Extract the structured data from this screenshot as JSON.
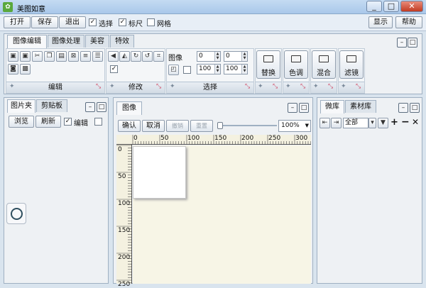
{
  "window": {
    "title": "美图如意",
    "min": "_",
    "max": "□",
    "close": "✕"
  },
  "toolbar": {
    "open": "打开",
    "save": "保存",
    "exit": "退出",
    "select": "选择",
    "ruler": "标尺",
    "grid": "网格",
    "show": "显示",
    "help": "帮助"
  },
  "ribbon": {
    "tabs": [
      "图像编辑",
      "图像处理",
      "美容",
      "特效"
    ],
    "groups": {
      "edit": "编辑",
      "modify": "修改",
      "select": "选择"
    },
    "image_label": "图像",
    "spinners": [
      "0",
      "0",
      "100",
      "100"
    ],
    "big_buttons": [
      "替换",
      "色调",
      "混合",
      "滤镜"
    ]
  },
  "left_panel": {
    "tabs": [
      "图片夹",
      "剪贴板"
    ],
    "browse": "浏览",
    "refresh": "刷新",
    "edit_check": "编辑"
  },
  "center_panel": {
    "tab": "图像",
    "confirm": "确认",
    "cancel": "取消",
    "undo": "撤销",
    "reset": "重置",
    "zoom": "100%",
    "hruler": [
      "0",
      "50",
      "100",
      "150",
      "200",
      "250",
      "300"
    ],
    "vruler": [
      "0",
      "50",
      "100",
      "150",
      "200",
      "250"
    ]
  },
  "right_panel": {
    "tabs": [
      "微库",
      "素材库"
    ],
    "all": "全部"
  },
  "checks": {
    "select": true,
    "ruler": true,
    "grid": false,
    "modify": true,
    "edit": true
  },
  "colors": {
    "accent": "#a9c8ea",
    "panel": "#eef1f4",
    "canvas": "#f7f5e6"
  }
}
